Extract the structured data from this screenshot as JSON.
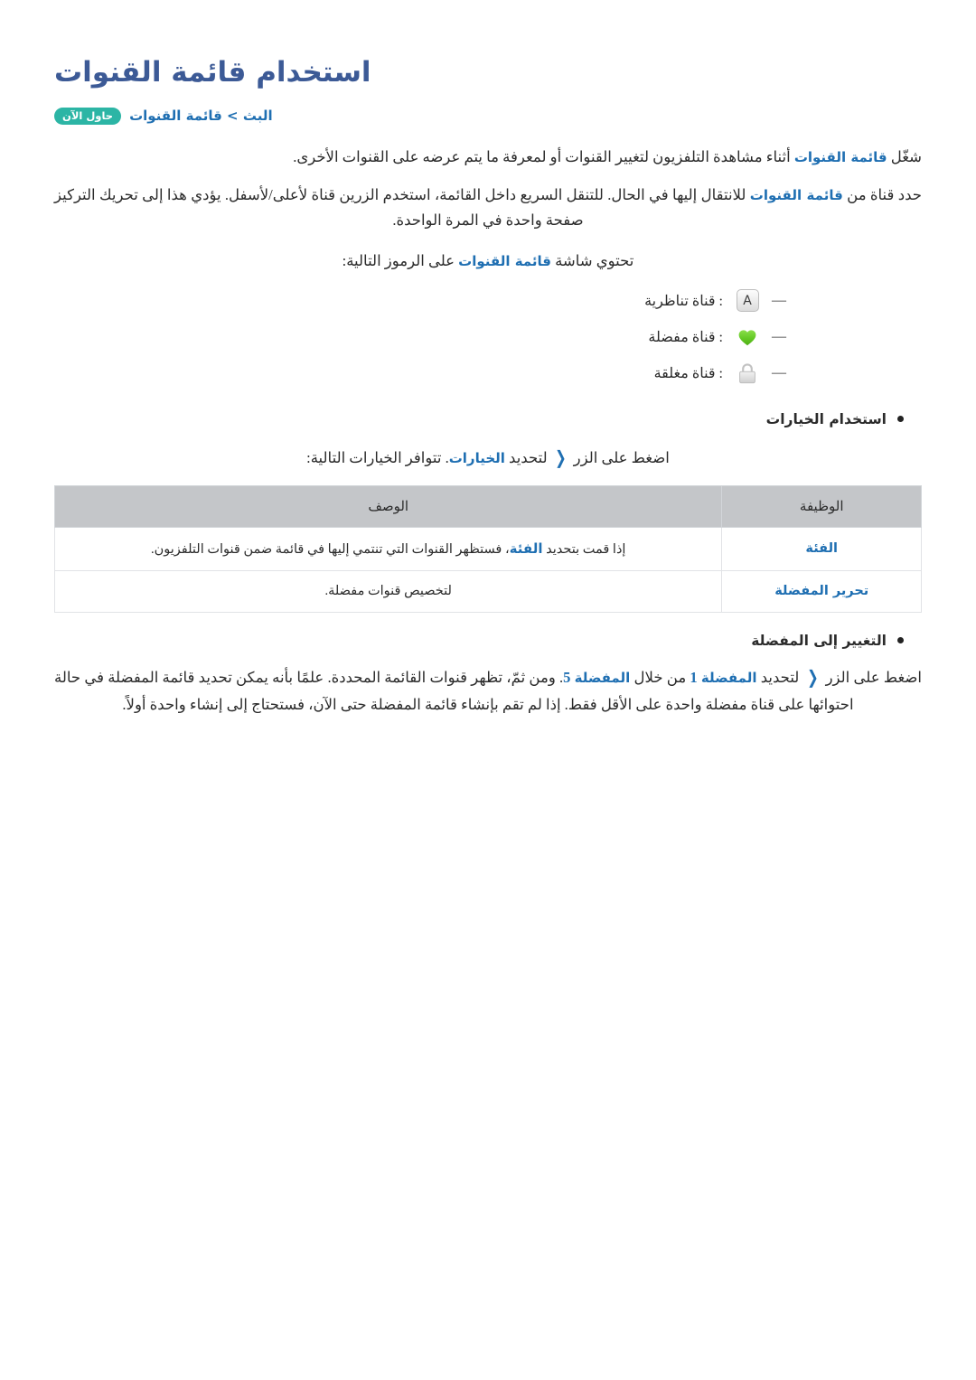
{
  "document": {
    "title": "استخدام قائمة القنوات",
    "breadcrumb": "البث > قائمة القنوات",
    "try_now_badge": "حاول الآن",
    "colors": {
      "title": "#3c5a96",
      "link": "#1f6fb2",
      "badge": "#2cb5a5",
      "table_header": "#c4c6c9",
      "heart": "#5cc626",
      "lock": "#d0d0d0"
    }
  },
  "paragraphs": {
    "p1": {
      "before": "شغّل ",
      "link": "قائمة القنوات",
      "after": " أثناء مشاهدة التلفزيون لتغيير القنوات أو لمعرفة ما يتم عرضه على القنوات الأخرى."
    },
    "p2": {
      "before": "حدد قناة من ",
      "link": "قائمة القنوات",
      "after": " للانتقال إليها في الحال. للتنقل السريع داخل القائمة، استخدم الزرين قناة لأعلى/لأسفل. يؤدي هذا إلى تحريك التركيز صفحة واحدة في المرة الواحدة."
    },
    "intro_icons": {
      "before": "تحتوي شاشة ",
      "link": "قائمة القنوات",
      "after": " على الرموز التالية:"
    },
    "options_intro": {
      "before": "اضغط على الزر ",
      "chevron": "❮",
      "mid": " لتحديد ",
      "link": "الخيارات",
      "after": ". تتوافر الخيارات التالية:"
    },
    "favorites_body": {
      "before": "اضغط على الزر ",
      "chevron": "❮",
      "mid1": " لتحديد ",
      "link1": "المفضلة",
      "num1": "1",
      "mid2": " من خلال ",
      "link2": "المفضلة",
      "num2": "5",
      "after": ". ومن ثمّ، تظهر قنوات القائمة المحددة. علمًا بأنه يمكن تحديد قائمة المفضلة في حالة احتوائها على قناة مفضلة واحدة على الأقل فقط. إذا لم تقم بإنشاء قائمة المفضلة حتى الآن، فستحتاج إلى إنشاء واحدة أولاً."
    }
  },
  "legend": {
    "items": [
      {
        "dash": "—",
        "icon": "analog-channel-icon",
        "icon_glyph": "A",
        "label": ": قناة تناظرية"
      },
      {
        "dash": "—",
        "icon": "favorite-heart-icon",
        "icon_glyph": "",
        "label": ": قناة مفضلة"
      },
      {
        "dash": "—",
        "icon": "locked-channel-icon",
        "icon_glyph": "",
        "label": ": قناة مغلقة"
      }
    ]
  },
  "sections": {
    "use_options_heading": "استخدام الخيارات",
    "change_to_favorites_heading": "التغيير إلى المفضلة"
  },
  "table": {
    "headers": {
      "function": "الوظيفة",
      "description": "الوصف"
    },
    "rows": [
      {
        "function": "الفئة",
        "desc_before": "إذا قمت بتحديد ",
        "desc_link": "الفئة",
        "desc_after": "، فستظهر القنوات التي تنتمي إليها في قائمة ضمن قنوات التلفزيون."
      },
      {
        "function": "تحرير المفضلة",
        "desc_before": "لتخصيص قنوات مفضلة.",
        "desc_link": "",
        "desc_after": ""
      }
    ]
  }
}
